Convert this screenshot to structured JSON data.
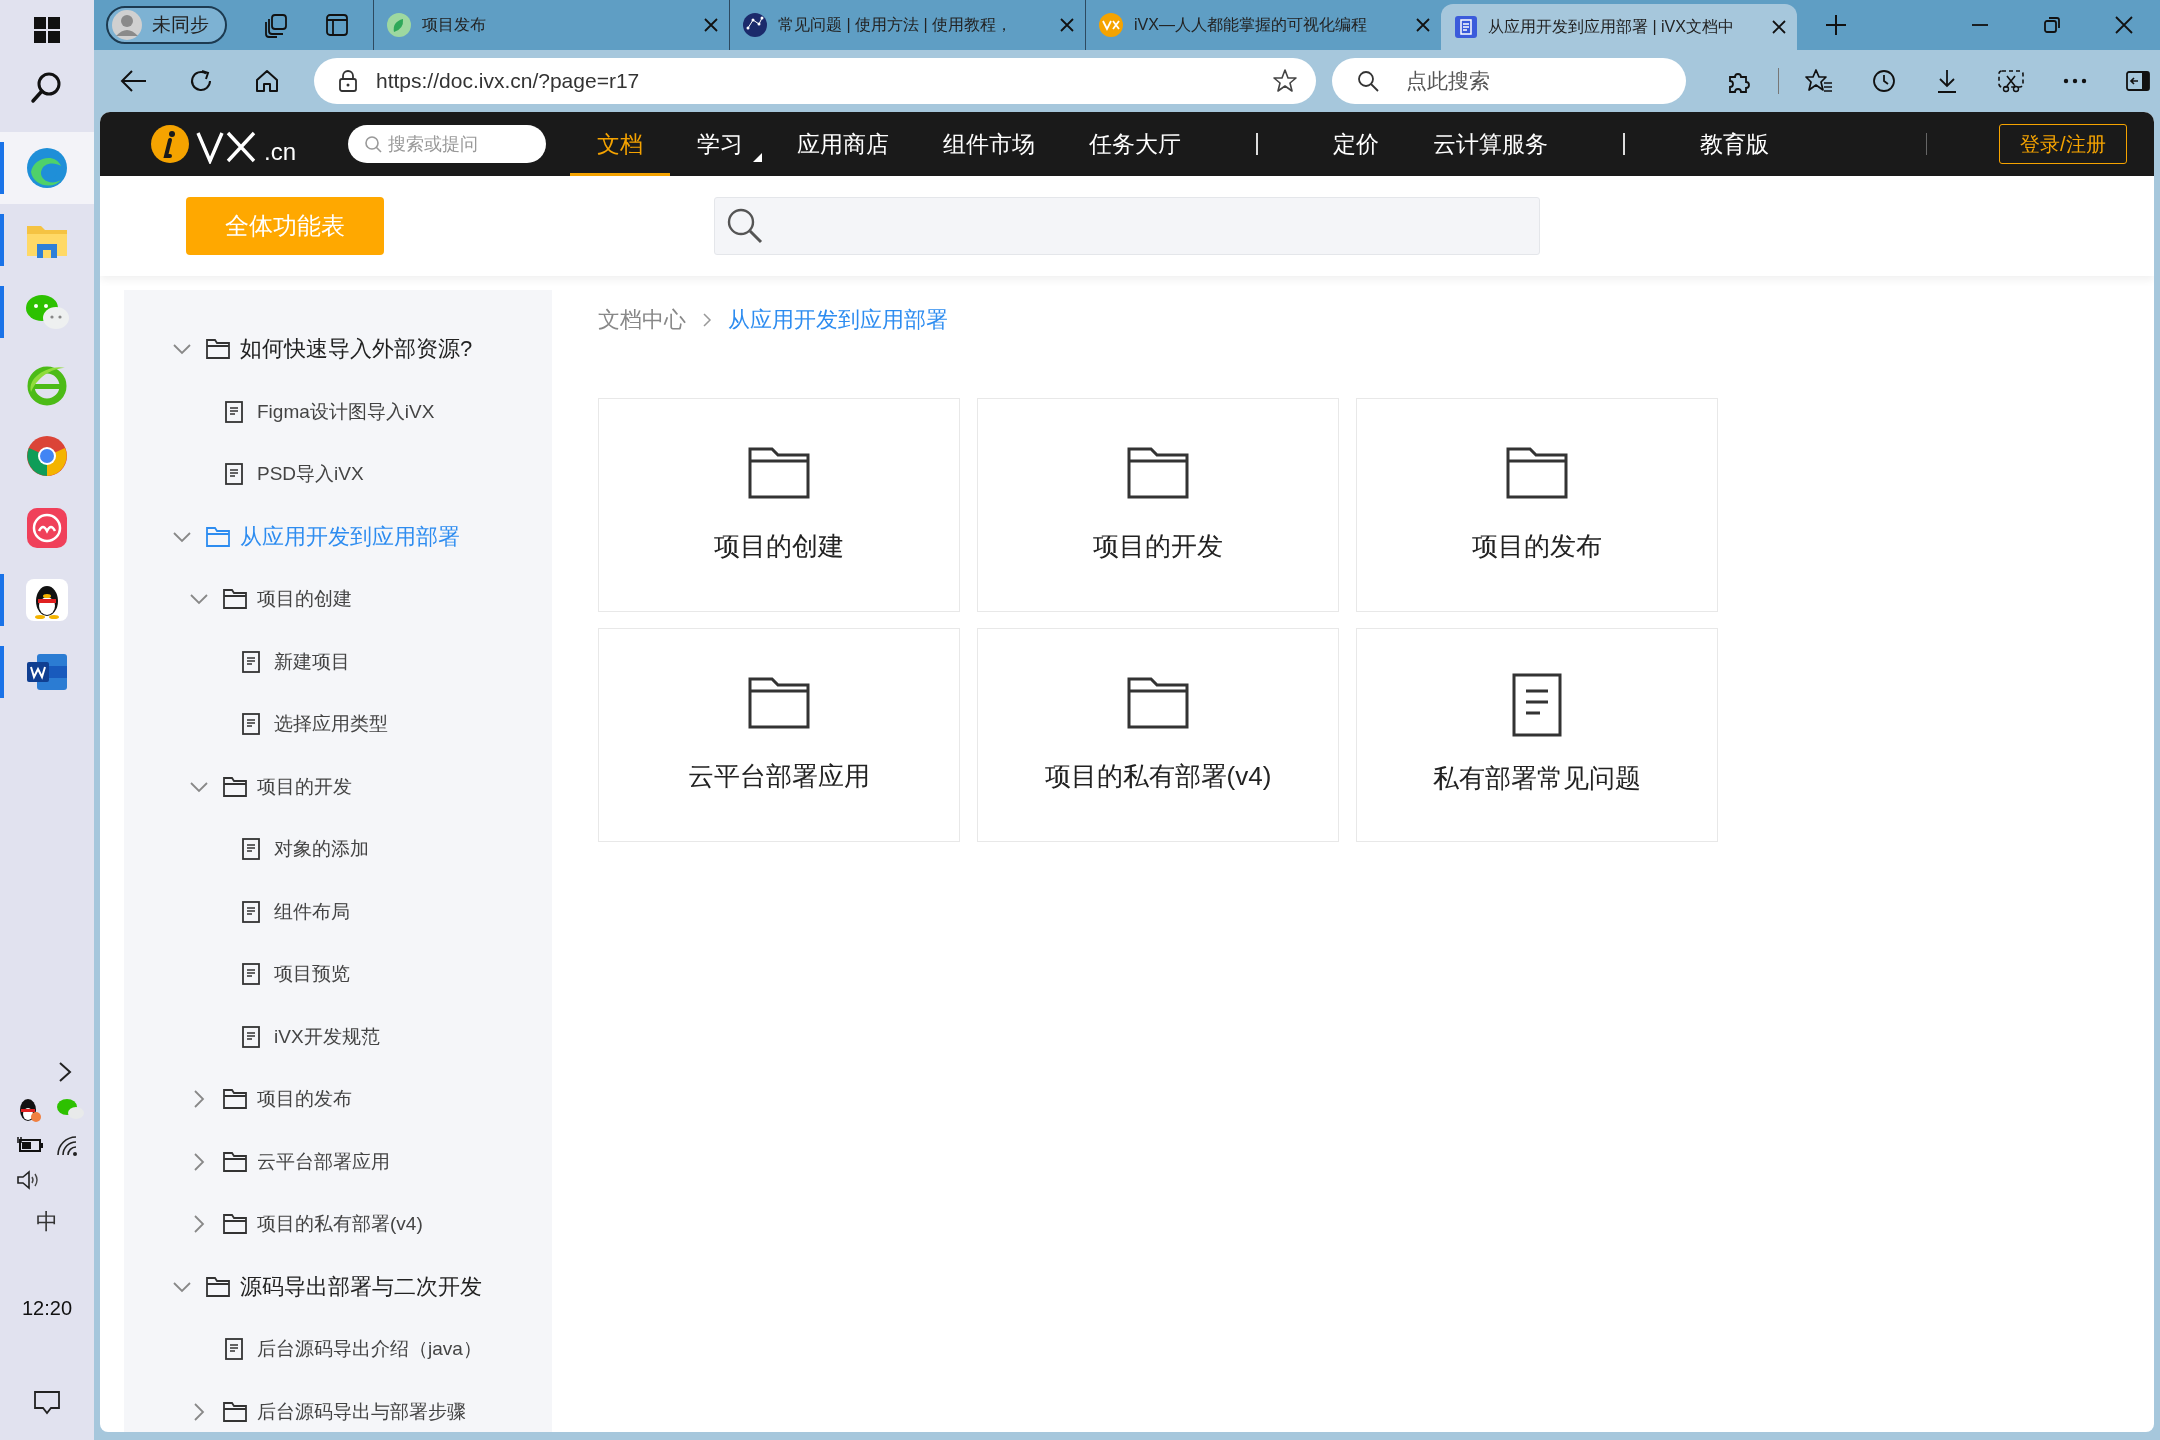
{
  "taskbar": {
    "apps": [
      {
        "running": true,
        "selected": true
      },
      {
        "running": true,
        "selected": false
      },
      {
        "running": true,
        "selected": false
      },
      {
        "running": false,
        "selected": false
      },
      {
        "running": false,
        "selected": false
      },
      {
        "running": false,
        "selected": false
      },
      {
        "running": true,
        "selected": false
      },
      {
        "running": true,
        "selected": false
      }
    ],
    "input_method": "中",
    "clock": "12:20"
  },
  "browser": {
    "profile": "未同步",
    "tabs": [
      {
        "title": "项目发布",
        "selected": false
      },
      {
        "title": "常见问题 | 使用方法 | 使用教程，",
        "selected": false
      },
      {
        "title": "iVX—人人都能掌握的可视化编程",
        "selected": false
      },
      {
        "title": "从应用开发到应用部署 | iVX文档中",
        "selected": true
      }
    ],
    "url": "https://doc.ivx.cn/?page=r17",
    "search_placeholder": "点此搜索"
  },
  "site_nav": {
    "logo_suffix": ".cn",
    "search_placeholder": "搜索或提问",
    "items": [
      {
        "kind": "link",
        "label": "文档",
        "selected": true,
        "dropdown": false
      },
      {
        "kind": "link",
        "label": "学习",
        "selected": false,
        "dropdown": true
      },
      {
        "kind": "link",
        "label": "应用商店",
        "selected": false,
        "dropdown": false
      },
      {
        "kind": "link",
        "label": "组件市场",
        "selected": false,
        "dropdown": false
      },
      {
        "kind": "link",
        "label": "任务大厅",
        "selected": false,
        "dropdown": false
      },
      {
        "kind": "separator"
      },
      {
        "kind": "link",
        "label": "定价",
        "selected": false,
        "dropdown": false
      },
      {
        "kind": "link",
        "label": "云计算服务",
        "selected": false,
        "dropdown": false
      },
      {
        "kind": "separator"
      },
      {
        "kind": "link",
        "label": "教育版",
        "selected": false,
        "dropdown": false
      },
      {
        "kind": "separator"
      }
    ],
    "login": "登录/注册"
  },
  "toolbar": {
    "all_features_button": "全体功能表"
  },
  "sidebar": {
    "items": [
      {
        "kind": "folder",
        "label": "如何快速导入外部资源?",
        "expanded": true,
        "selected": false,
        "children": [
          {
            "kind": "doc",
            "label": "Figma设计图导入iVX",
            "selected": false
          },
          {
            "kind": "doc",
            "label": "PSD导入iVX",
            "selected": false
          }
        ]
      },
      {
        "kind": "folder",
        "label": "从应用开发到应用部署",
        "expanded": true,
        "selected": true,
        "children": [
          {
            "kind": "folder",
            "label": "项目的创建",
            "expanded": true,
            "selected": false,
            "children": [
              {
                "kind": "doc",
                "label": "新建项目",
                "selected": false
              },
              {
                "kind": "doc",
                "label": "选择应用类型",
                "selected": false
              }
            ]
          },
          {
            "kind": "folder",
            "label": "项目的开发",
            "expanded": true,
            "selected": false,
            "children": [
              {
                "kind": "doc",
                "label": "对象的添加",
                "selected": false
              },
              {
                "kind": "doc",
                "label": "组件布局",
                "selected": false
              },
              {
                "kind": "doc",
                "label": "项目预览",
                "selected": false
              },
              {
                "kind": "doc",
                "label": "iVX开发规范",
                "selected": false
              }
            ]
          },
          {
            "kind": "folder",
            "label": "项目的发布",
            "expanded": false,
            "selected": false
          },
          {
            "kind": "folder",
            "label": "云平台部署应用",
            "expanded": false,
            "selected": false
          },
          {
            "kind": "folder",
            "label": "项目的私有部署(v4)",
            "expanded": false,
            "selected": false
          }
        ]
      },
      {
        "kind": "folder",
        "label": "源码导出部署与二次开发",
        "expanded": true,
        "selected": false,
        "children": [
          {
            "kind": "doc",
            "label": "后台源码导出介绍（java）",
            "selected": false
          },
          {
            "kind": "folder",
            "label": "后台源码导出与部署步骤",
            "expanded": false,
            "selected": false
          }
        ]
      }
    ]
  },
  "breadcrumb": [
    "文档中心",
    "从应用开发到应用部署"
  ],
  "cards": [
    {
      "kind": "folder",
      "label": "项目的创建"
    },
    {
      "kind": "folder",
      "label": "项目的开发"
    },
    {
      "kind": "folder",
      "label": "项目的发布"
    },
    {
      "kind": "folder",
      "label": "云平台部署应用"
    },
    {
      "kind": "folder",
      "label": "项目的私有部署(v4)"
    },
    {
      "kind": "doc",
      "label": "私有部署常见问题"
    }
  ]
}
